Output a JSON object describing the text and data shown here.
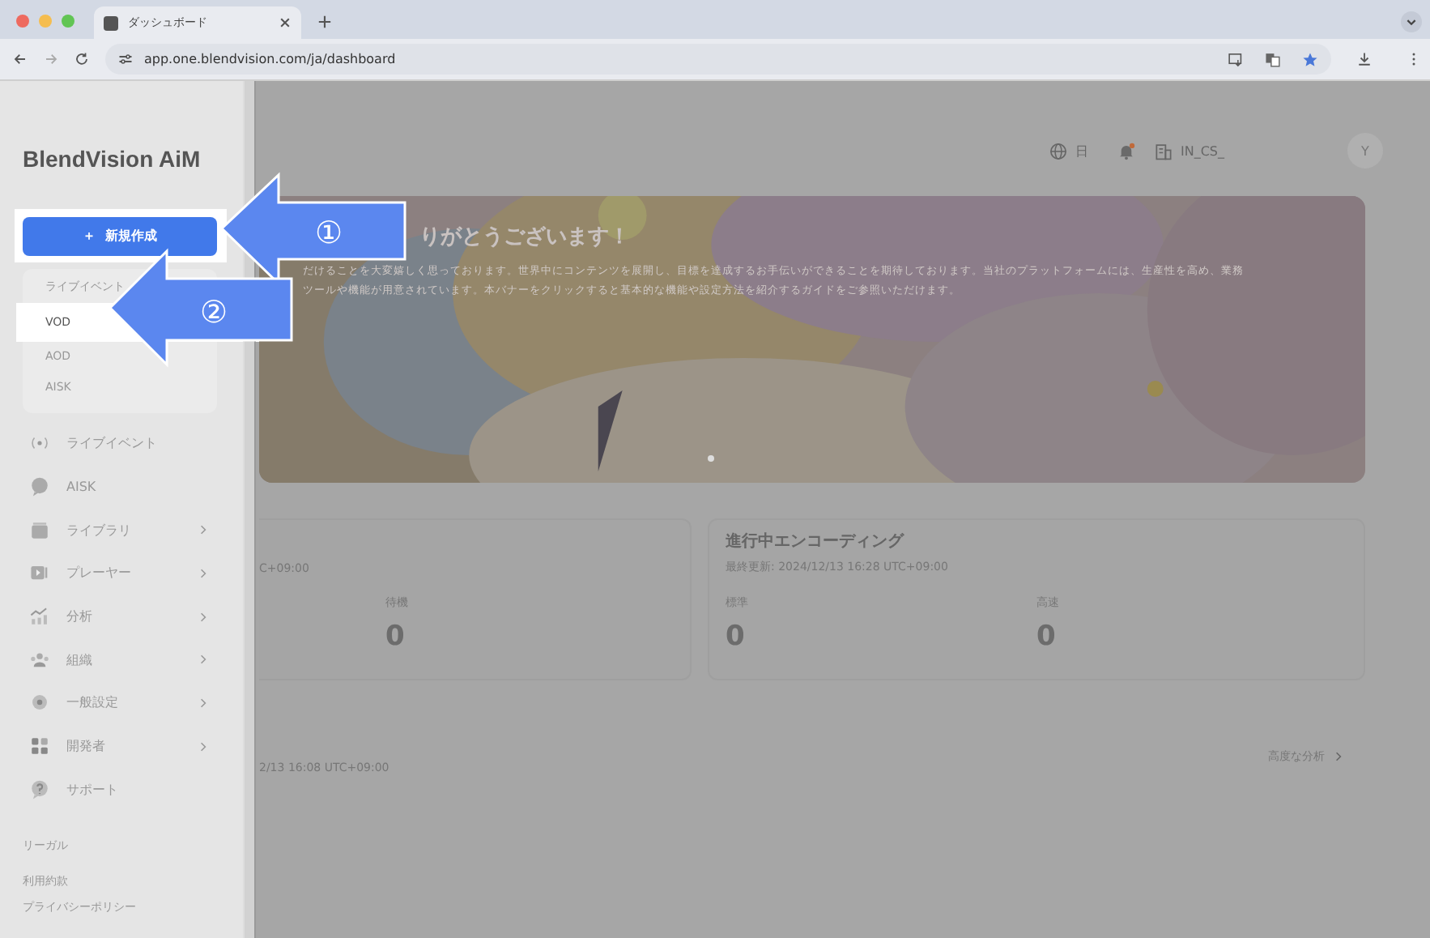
{
  "browser": {
    "tab_title": "ダッシュボード",
    "url": "app.one.blendvision.com/ja/dashboard"
  },
  "sidebar": {
    "logo": "BlendVision AiM",
    "create_button": "＋  新規作成",
    "create_menu": [
      {
        "label": "ライブイベント",
        "selected": false
      },
      {
        "label": "VOD",
        "selected": true
      },
      {
        "label": "AOD",
        "selected": false
      },
      {
        "label": "AISK",
        "selected": false
      }
    ],
    "nav": [
      {
        "label": "ライブイベント",
        "expandable": false
      },
      {
        "label": "AISK",
        "expandable": false
      },
      {
        "label": "ライブラリ",
        "expandable": true
      },
      {
        "label": "プレーヤー",
        "expandable": true
      },
      {
        "label": "分析",
        "expandable": true
      },
      {
        "label": "組織",
        "expandable": true
      },
      {
        "label": "一般設定",
        "expandable": true
      },
      {
        "label": "開発者",
        "expandable": true
      },
      {
        "label": "サポート",
        "expandable": false
      }
    ],
    "footer_links": [
      "リーガル",
      "利用約款",
      "プライバシーポリシー"
    ]
  },
  "header": {
    "language": "日",
    "notification_dot": true,
    "organization": "IN_CS_",
    "avatar": "Y"
  },
  "banner": {
    "title": "りがとうございます！",
    "text_line_1": "だけることを大変嬉しく思っております。世界中にコンテンツを展開し、目標を達成するお手伝いができることを期待しております。当社のプラットフォームには、生産性を高め、業務",
    "text_line_2": "ツールや機能が用意されています。本バナーをクリックすると基本的な機能や設定方法を紹介するガイドをご参照いただけます。"
  },
  "stats_left": {
    "updated": "C+09:00",
    "metrics": [
      {
        "label": "待機",
        "value": "0"
      }
    ]
  },
  "stats_right": {
    "title": "進行中エンコーディング",
    "updated": "最終更新: 2024/12/13 16:28 UTC+09:00",
    "metrics": [
      {
        "label": "標準",
        "value": "0"
      },
      {
        "label": "高速",
        "value": "0"
      }
    ]
  },
  "analytics": {
    "updated": "2/13 16:08 UTC+09:00",
    "link": "高度な分析"
  },
  "callouts": [
    "①",
    "②"
  ]
}
